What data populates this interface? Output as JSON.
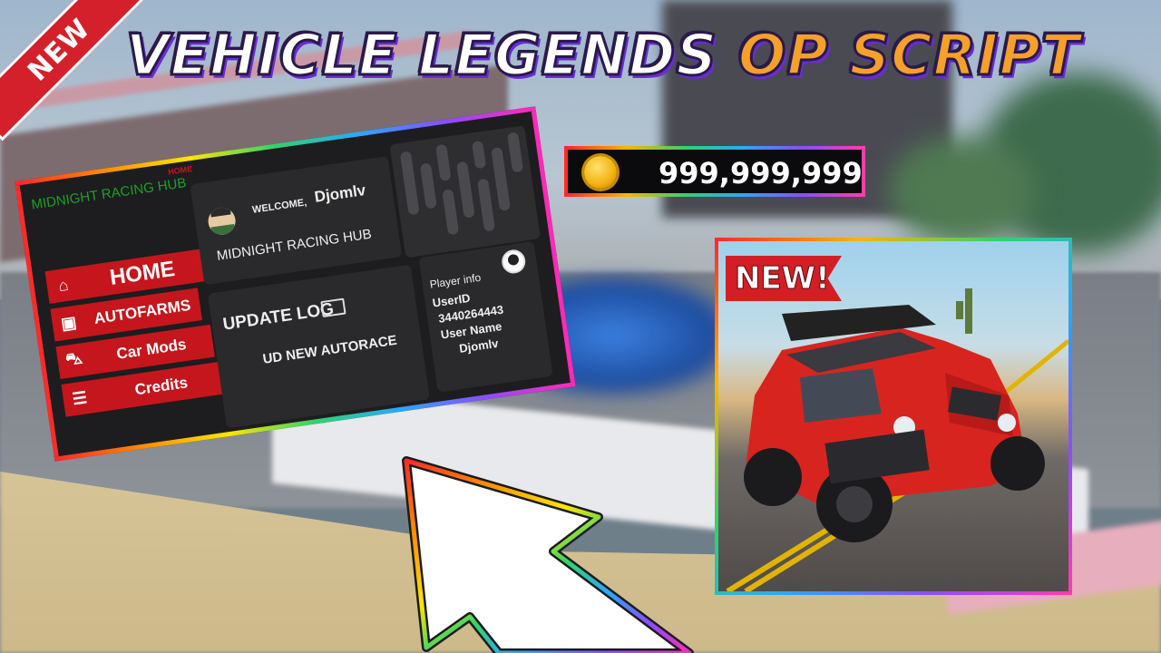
{
  "ribbon": {
    "label": "NEW"
  },
  "headline": {
    "main": "VEHICLE LEGENDS",
    "highlight": "OP SCRIPT"
  },
  "currency": {
    "amount": "999,999,999",
    "icon": "coin-icon"
  },
  "thumbnail": {
    "tag": "NEW!"
  },
  "script_window": {
    "hub_title": "MIDNIGHT RACING HUB",
    "active_tab_label": "HOME",
    "nav": [
      {
        "label": "HOME",
        "icon": "home-icon"
      },
      {
        "label": "AUTOFARMS",
        "icon": "money-icon"
      },
      {
        "label": "Car Mods",
        "icon": "car-icon"
      },
      {
        "label": "Credits",
        "icon": "list-icon"
      }
    ],
    "welcome": {
      "prefix": "WELCOME,",
      "username": "Djomlv",
      "hub_name": "MIDNIGHT RACING HUB"
    },
    "update_log": {
      "title": "UPDATE LOG",
      "entry": "UD NEW AUTORACE"
    },
    "player_info": {
      "title": "Player info",
      "user_id_label": "UserID",
      "user_id": "3440264443",
      "user_name_label": "User Name",
      "user_name": "Djomlv"
    }
  },
  "colors": {
    "accent_red": "#c4161c",
    "hub_green": "#1aa12a",
    "gold": "#f5a02a"
  }
}
